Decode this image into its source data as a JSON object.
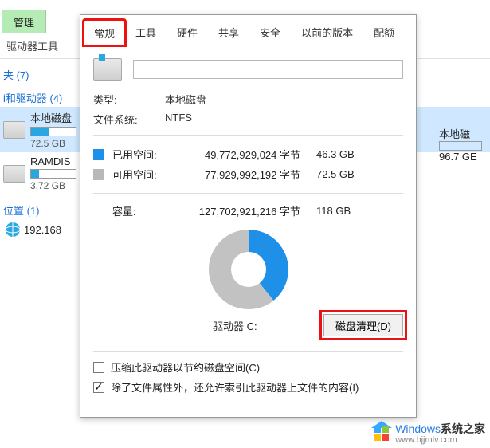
{
  "explorer": {
    "header_tab": "管理",
    "row2": "驱动器工具",
    "folder_label": "夹 (7)",
    "drives_header": "i和驱动器 (4)",
    "drive_c": {
      "title": "本地磁盘",
      "sub": "72.5 GB",
      "fill_pct": 40
    },
    "drive_d": {
      "title": "RAMDIS",
      "sub": "3.72 GB",
      "fill_pct": 18
    },
    "net_label": "位置 (1)",
    "net_entry": "192.168",
    "drive_right": {
      "title": "本地磁",
      "sub": "96.7 GE",
      "fill_pct": 5
    }
  },
  "dialog": {
    "tabs": [
      "常规",
      "工具",
      "硬件",
      "共享",
      "安全",
      "以前的版本",
      "配额"
    ],
    "active_tab_index": 0,
    "type_label": "类型:",
    "type_value": "本地磁盘",
    "fs_label": "文件系统:",
    "fs_value": "NTFS",
    "used_label": "已用空间:",
    "used_bytes": "49,772,929,024 字节",
    "used_gb": "46.3 GB",
    "free_label": "可用空间:",
    "free_bytes": "77,929,992,192 字节",
    "free_gb": "72.5 GB",
    "cap_label": "容量:",
    "cap_bytes": "127,702,921,216 字节",
    "cap_gb": "118 GB",
    "drive_name": "驱动器 C:",
    "cleanup_button": "磁盘清理(D)",
    "compress_label": "压缩此驱动器以节约磁盘空间(C)",
    "index_label": "除了文件属性外，还允许索引此驱动器上文件的内容(I)",
    "compress_checked": false,
    "index_checked": true,
    "used_pct": 39.2
  },
  "watermark": {
    "brand": "Windows",
    "suffix": "系统之家",
    "url": "www.bjjmlv.com"
  }
}
